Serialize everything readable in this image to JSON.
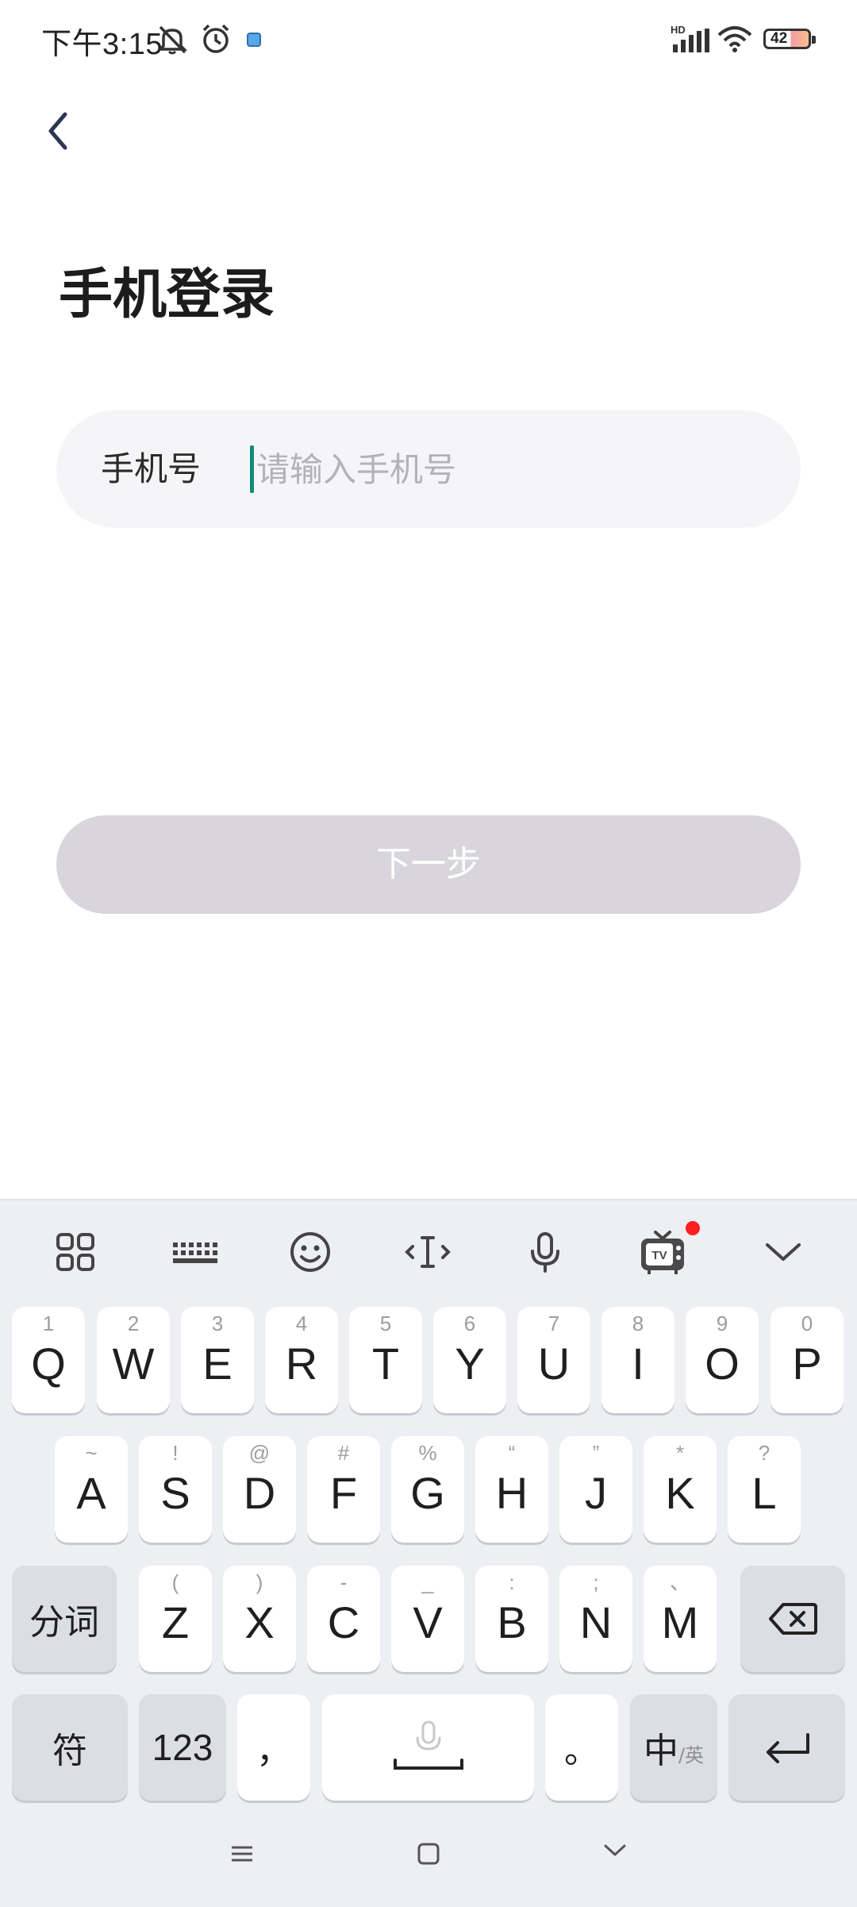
{
  "status_bar": {
    "time": "下午3:15",
    "battery_level": "42",
    "network_label": "HD",
    "icons": [
      "mute-icon",
      "alarm-icon",
      "app-notification-icon",
      "signal-icon",
      "wifi-icon",
      "battery-icon"
    ]
  },
  "page": {
    "back_icon": "chevron-left-icon",
    "title": "手机登录",
    "phone_label": "手机号",
    "phone_placeholder": "请输入手机号",
    "phone_value": "",
    "next_button": "下一步",
    "next_button_enabled": false
  },
  "keyboard": {
    "toolbar": [
      "apps-grid-icon",
      "keyboard-icon",
      "emoji-icon",
      "cursor-icon",
      "mic-icon",
      "tv-icon",
      "collapse-icon"
    ],
    "row1": [
      {
        "main": "Q",
        "hint": "1"
      },
      {
        "main": "W",
        "hint": "2"
      },
      {
        "main": "E",
        "hint": "3"
      },
      {
        "main": "R",
        "hint": "4"
      },
      {
        "main": "T",
        "hint": "5"
      },
      {
        "main": "Y",
        "hint": "6"
      },
      {
        "main": "U",
        "hint": "7"
      },
      {
        "main": "I",
        "hint": "8"
      },
      {
        "main": "O",
        "hint": "9"
      },
      {
        "main": "P",
        "hint": "0"
      }
    ],
    "row2": [
      {
        "main": "A",
        "hint": "~"
      },
      {
        "main": "S",
        "hint": "!"
      },
      {
        "main": "D",
        "hint": "@"
      },
      {
        "main": "F",
        "hint": "#"
      },
      {
        "main": "G",
        "hint": "%"
      },
      {
        "main": "H",
        "hint": "“"
      },
      {
        "main": "J",
        "hint": "”"
      },
      {
        "main": "K",
        "hint": "*"
      },
      {
        "main": "L",
        "hint": "?"
      }
    ],
    "row3": [
      {
        "main": "Z",
        "hint": "("
      },
      {
        "main": "X",
        "hint": ")"
      },
      {
        "main": "C",
        "hint": "-"
      },
      {
        "main": "V",
        "hint": "_"
      },
      {
        "main": "B",
        "hint": ":"
      },
      {
        "main": "N",
        "hint": ";"
      },
      {
        "main": "M",
        "hint": "、"
      }
    ],
    "segment_key": "分词",
    "symbol_key": "符",
    "number_key": "123",
    "comma_key": "，",
    "period_key": "。",
    "lang_key_main": "中",
    "lang_key_alt": "/英",
    "space_icon": "mic-space-icon",
    "backspace_icon": "backspace-icon",
    "enter_icon": "enter-icon"
  },
  "nav_bar": [
    "menu-icon",
    "home-icon",
    "back-down-icon"
  ]
}
